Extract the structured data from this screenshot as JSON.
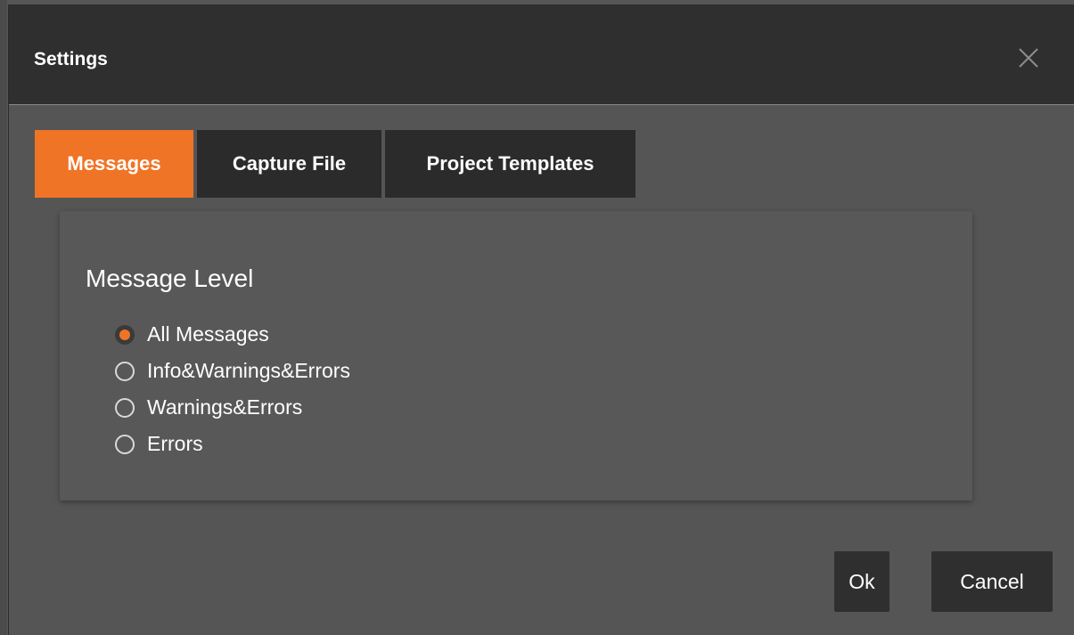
{
  "dialog": {
    "title": "Settings",
    "close_icon": "close-icon"
  },
  "tabs": [
    {
      "label": "Messages",
      "active": true
    },
    {
      "label": "Capture File",
      "active": false
    },
    {
      "label": "Project Templates",
      "active": false
    }
  ],
  "messages_panel": {
    "heading": "Message Level",
    "options": [
      {
        "label": "All Messages",
        "selected": true
      },
      {
        "label": "Info&Warnings&Errors",
        "selected": false
      },
      {
        "label": "Warnings&Errors",
        "selected": false
      },
      {
        "label": "Errors",
        "selected": false
      }
    ]
  },
  "footer": {
    "ok_label": "Ok",
    "cancel_label": "Cancel"
  },
  "colors": {
    "accent": "#f07425",
    "titlebar": "#2f2f2f",
    "background": "#565656"
  }
}
